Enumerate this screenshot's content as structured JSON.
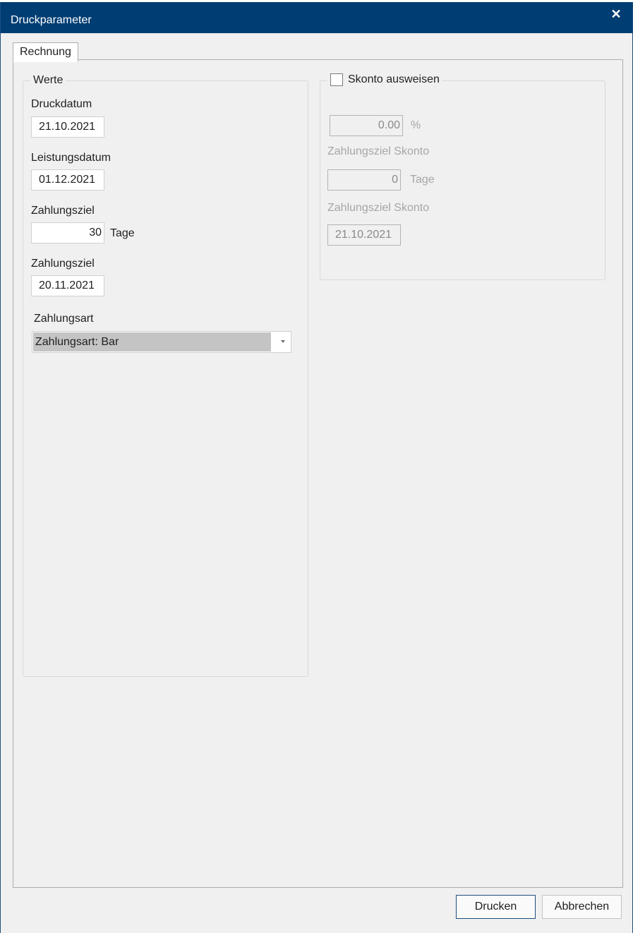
{
  "dialog": {
    "title": "Druckparameter",
    "close_glyph": "✕"
  },
  "tabs": [
    {
      "label": "Rechnung",
      "selected": true
    }
  ],
  "werte": {
    "legend": "Werte",
    "druckdatum_label": "Druckdatum",
    "druckdatum_value": "21.10.2021",
    "leistungsdatum_label": "Leistungsdatum",
    "leistungsdatum_value": "01.12.2021",
    "zahlungsziel_tage_label": "Zahlungsziel",
    "zahlungsziel_tage_value": "30",
    "tage_unit": "Tage",
    "zahlungsziel_datum_label": "Zahlungsziel",
    "zahlungsziel_datum_value": "20.11.2021",
    "zahlungsart_label": "Zahlungsart",
    "zahlungsart_selected": "Zahlungsart: Bar"
  },
  "skonto": {
    "checkbox_label": "Skonto ausweisen",
    "checked": false,
    "percent_value": "0.00",
    "percent_unit": "%",
    "ziel_tage_label": "Zahlungsziel Skonto",
    "ziel_tage_value": "0",
    "tage_unit": "Tage",
    "ziel_datum_label": "Zahlungsziel Skonto",
    "ziel_datum_value": "21.10.2021"
  },
  "buttons": {
    "print_label": "Drucken",
    "cancel_label": "Abbrechen"
  },
  "colors": {
    "titlebar": "#003d73",
    "background": "#f0f0f0",
    "combo_selection": "#c4c4c4",
    "disabled_text": "#a6a6a6"
  }
}
